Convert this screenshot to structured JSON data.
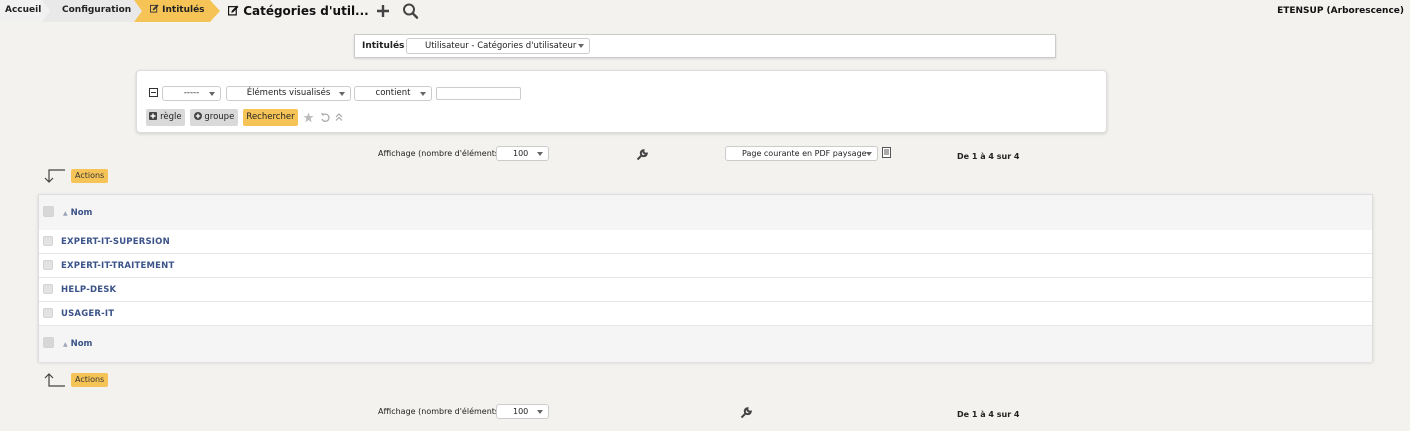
{
  "breadcrumb": {
    "home": "Accueil",
    "configuration": "Configuration",
    "current": "Intitulés"
  },
  "header": {
    "title": "Catégories d'util...",
    "site": "ETENSUP (Arborescence)",
    "add_icon": "plus-icon",
    "search_icon": "magnifier-icon"
  },
  "intitules": {
    "label": "Intitulés",
    "selected": "Utilisateur - Catégories d'utilisateur"
  },
  "search": {
    "field1": "-----",
    "field2": "Éléments visualisés",
    "operator": "contient",
    "value": "",
    "rule_button": "règle",
    "group_button": "groupe",
    "search_button": "Rechercher"
  },
  "pagination_top": {
    "display_label": "Affichage (nombre d'éléments)",
    "per_page": "100",
    "export_option": "Page courante en PDF paysage",
    "count": "De 1 à 4 sur 4"
  },
  "actions_label": "Actions",
  "table": {
    "column": "Nom",
    "rows": [
      "EXPERT-IT-SUPERSION",
      "EXPERT-IT-TRAITEMENT",
      "HELP-DESK",
      "USAGER-IT"
    ]
  },
  "pagination_bottom": {
    "display_label": "Affichage (nombre d'éléments)",
    "per_page": "100",
    "count": "De 1 à 4 sur 4"
  },
  "colors": {
    "accent": "#f6c456",
    "link": "#3b5389",
    "background": "#f4f2ef"
  }
}
